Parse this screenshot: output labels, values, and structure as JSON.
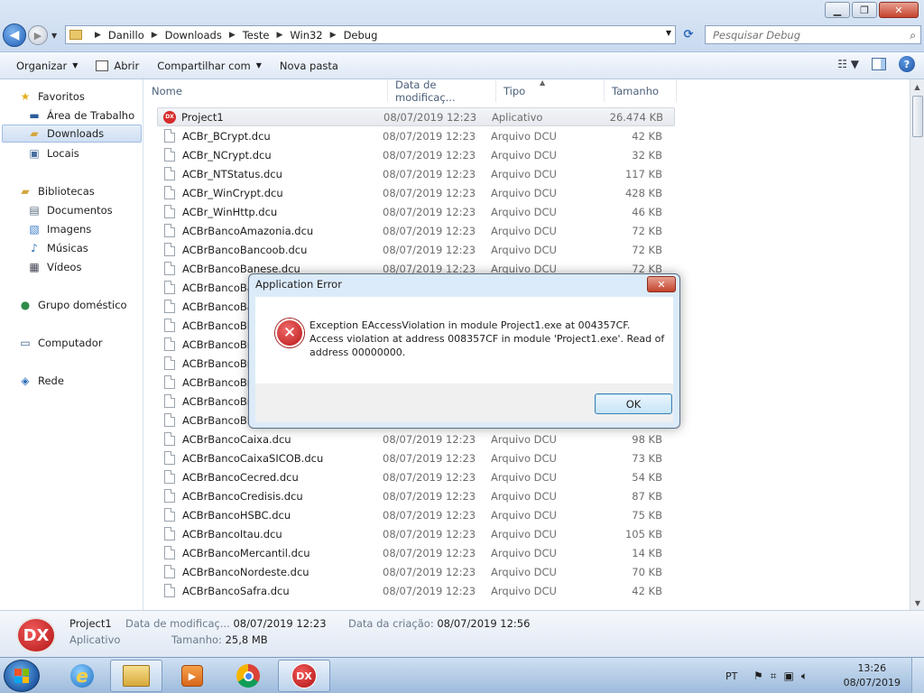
{
  "window": {
    "minimize": "▁",
    "maximize": "❐",
    "close": "✕"
  },
  "address": {
    "crumbs": [
      "Danillo",
      "Downloads",
      "Teste",
      "Win32",
      "Debug"
    ],
    "search_placeholder": "Pesquisar Debug"
  },
  "toolbar": {
    "organize": "Organizar",
    "open": "Abrir",
    "share": "Compartilhar com",
    "new_folder": "Nova pasta"
  },
  "nav": {
    "favorites": "Favoritos",
    "desktop": "Área de Trabalho",
    "downloads": "Downloads",
    "places": "Locais",
    "libraries": "Bibliotecas",
    "documents": "Documentos",
    "images": "Imagens",
    "music": "Músicas",
    "videos": "Vídeos",
    "homegroup": "Grupo doméstico",
    "computer": "Computador",
    "network": "Rede"
  },
  "columns": {
    "name": "Nome",
    "date": "Data de modificaç...",
    "type": "Tipo",
    "size": "Tamanho"
  },
  "files": [
    {
      "name": "Project1",
      "date": "08/07/2019 12:23",
      "type": "Aplicativo",
      "size": "26.474 KB"
    },
    {
      "name": "ACBr_BCrypt.dcu",
      "date": "08/07/2019 12:23",
      "type": "Arquivo DCU",
      "size": "42 KB"
    },
    {
      "name": "ACBr_NCrypt.dcu",
      "date": "08/07/2019 12:23",
      "type": "Arquivo DCU",
      "size": "32 KB"
    },
    {
      "name": "ACBr_NTStatus.dcu",
      "date": "08/07/2019 12:23",
      "type": "Arquivo DCU",
      "size": "117 KB"
    },
    {
      "name": "ACBr_WinCrypt.dcu",
      "date": "08/07/2019 12:23",
      "type": "Arquivo DCU",
      "size": "428 KB"
    },
    {
      "name": "ACBr_WinHttp.dcu",
      "date": "08/07/2019 12:23",
      "type": "Arquivo DCU",
      "size": "46 KB"
    },
    {
      "name": "ACBrBancoAmazonia.dcu",
      "date": "08/07/2019 12:23",
      "type": "Arquivo DCU",
      "size": "72 KB"
    },
    {
      "name": "ACBrBancoBancoob.dcu",
      "date": "08/07/2019 12:23",
      "type": "Arquivo DCU",
      "size": "72 KB"
    },
    {
      "name": "ACBrBancoBanese.dcu",
      "date": "08/07/2019 12:23",
      "type": "Arquivo DCU",
      "size": "72 KB"
    },
    {
      "name": "ACBrBancoBan",
      "date": "",
      "type": "",
      "size": ""
    },
    {
      "name": "ACBrBancoBan",
      "date": "",
      "type": "",
      "size": ""
    },
    {
      "name": "ACBrBancoBic",
      "date": "",
      "type": "",
      "size": ""
    },
    {
      "name": "ACBrBancoBra",
      "date": "",
      "type": "",
      "size": ""
    },
    {
      "name": "ACBrBancoBra",
      "date": "",
      "type": "",
      "size": ""
    },
    {
      "name": "ACBrBancoBra",
      "date": "",
      "type": "",
      "size": ""
    },
    {
      "name": "ACBrBancoBra",
      "date": "",
      "type": "",
      "size": ""
    },
    {
      "name": "ACBrBancoBRE",
      "date": "",
      "type": "",
      "size": ""
    },
    {
      "name": "ACBrBancoCaixa.dcu",
      "date": "08/07/2019 12:23",
      "type": "Arquivo DCU",
      "size": "98 KB"
    },
    {
      "name": "ACBrBancoCaixaSICOB.dcu",
      "date": "08/07/2019 12:23",
      "type": "Arquivo DCU",
      "size": "73 KB"
    },
    {
      "name": "ACBrBancoCecred.dcu",
      "date": "08/07/2019 12:23",
      "type": "Arquivo DCU",
      "size": "54 KB"
    },
    {
      "name": "ACBrBancoCredisis.dcu",
      "date": "08/07/2019 12:23",
      "type": "Arquivo DCU",
      "size": "87 KB"
    },
    {
      "name": "ACBrBancoHSBC.dcu",
      "date": "08/07/2019 12:23",
      "type": "Arquivo DCU",
      "size": "75 KB"
    },
    {
      "name": "ACBrBancoItau.dcu",
      "date": "08/07/2019 12:23",
      "type": "Arquivo DCU",
      "size": "105 KB"
    },
    {
      "name": "ACBrBancoMercantil.dcu",
      "date": "08/07/2019 12:23",
      "type": "Arquivo DCU",
      "size": "14 KB"
    },
    {
      "name": "ACBrBancoNordeste.dcu",
      "date": "08/07/2019 12:23",
      "type": "Arquivo DCU",
      "size": "70 KB"
    },
    {
      "name": "ACBrBancoSafra.dcu",
      "date": "08/07/2019 12:23",
      "type": "Arquivo DCU",
      "size": "42 KB"
    }
  ],
  "details": {
    "name": "Project1",
    "kind": "Aplicativo",
    "modified_label": "Data de modificaç...",
    "modified_value": "08/07/2019 12:23",
    "created_label": "Data da criação:",
    "created_value": "08/07/2019 12:56",
    "size_label": "Tamanho:",
    "size_value": "25,8 MB",
    "icon_text": "DX"
  },
  "dialog": {
    "title": "Application Error",
    "line1": "Exception EAccessViolation in module Project1.exe at 004357CF.",
    "line2": "Access violation at address 008357CF in module 'Project1.exe'. Read of address 00000000.",
    "ok": "OK"
  },
  "taskbar": {
    "language": "PT",
    "time": "13:26",
    "date": "08/07/2019",
    "dx_label": "DX"
  }
}
